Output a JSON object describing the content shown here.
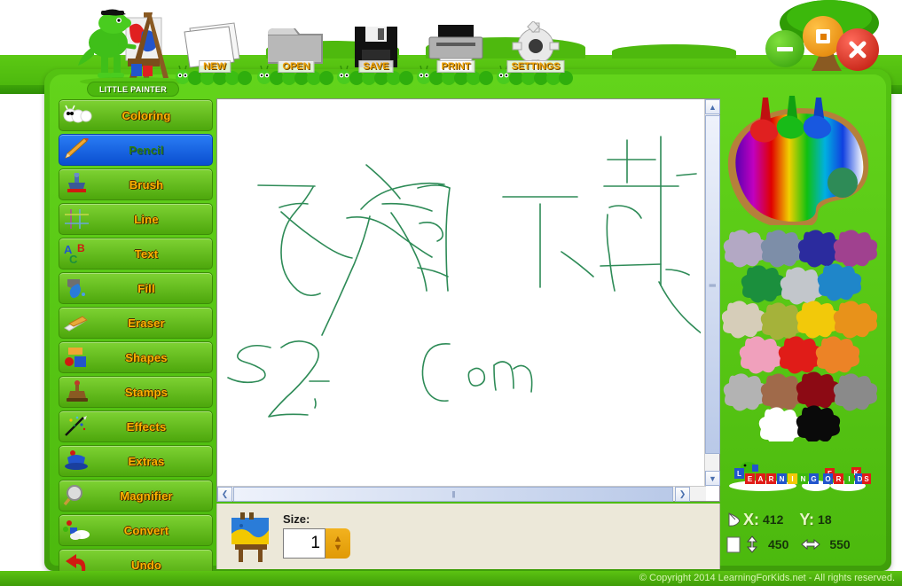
{
  "app": {
    "title": "LITTLE PAINTER",
    "footer": "© Copyright 2014 LearningForKids.net - All rights reserved."
  },
  "window_controls": [
    {
      "name": "minimize",
      "label": "–"
    },
    {
      "name": "maximize",
      "label": "□"
    },
    {
      "name": "close",
      "label": "✕"
    }
  ],
  "toolbar": {
    "items": [
      {
        "label": "NEW",
        "icon": "new-page-icon"
      },
      {
        "label": "OPEN",
        "icon": "open-folder-icon"
      },
      {
        "label": "SAVE",
        "icon": "floppy-disk-icon"
      },
      {
        "label": "PRINT",
        "icon": "printer-icon"
      },
      {
        "label": "SETTINGS",
        "icon": "gear-icon"
      }
    ]
  },
  "sidebar": {
    "items": [
      {
        "label": "Coloring",
        "icon": "caterpillar-icon",
        "active": false
      },
      {
        "label": "Pencil",
        "icon": "pencil-icon",
        "active": true
      },
      {
        "label": "Brush",
        "icon": "brush-icon",
        "active": false
      },
      {
        "label": "Line",
        "icon": "grid-lines-icon",
        "active": false
      },
      {
        "label": "Text",
        "icon": "abc-letters-icon",
        "active": false
      },
      {
        "label": "Fill",
        "icon": "paint-bucket-icon",
        "active": false
      },
      {
        "label": "Eraser",
        "icon": "eraser-icon",
        "active": false
      },
      {
        "label": "Shapes",
        "icon": "shapes-icon",
        "active": false
      },
      {
        "label": "Stamps",
        "icon": "stamp-icon",
        "active": false
      },
      {
        "label": "Effects",
        "icon": "magic-wand-icon",
        "active": false
      },
      {
        "label": "Extras",
        "icon": "hat-icon",
        "active": false
      },
      {
        "label": "Magnifier",
        "icon": "magnifier-icon",
        "active": false
      },
      {
        "label": "Convert",
        "icon": "convert-icon",
        "active": false
      },
      {
        "label": "Undo",
        "icon": "undo-arrow-icon",
        "active": false
      }
    ]
  },
  "options": {
    "easel_icon": "easel-icon",
    "size_label": "Size:",
    "size_value": "1",
    "spinner_up": "▲",
    "spinner_down": "▼"
  },
  "canvas": {
    "drawing_color": "#2e8b57",
    "strokes_description": "hand-drawn green text",
    "line1": "飞翔下载",
    "line2": "52Z.com"
  },
  "scrollbars": {
    "v_up": "▲",
    "v_down": "▼",
    "h_left": "❮",
    "h_right": "❯",
    "grip": "|||"
  },
  "palette": {
    "selected_color": "#2e8b57",
    "swatches": [
      [
        "#b3a8c4",
        "#7d8ea8",
        "#2b2b9e",
        "#a0418f"
      ],
      [
        "#1b8f3d",
        "#c2c6cb",
        "#1f86c9"
      ],
      [
        "#d6cdb9",
        "#a5b23a",
        "#f2c90a",
        "#e8921a"
      ],
      [
        "#f0a0bc",
        "#e01c18",
        "#ec8326"
      ],
      [
        "#b3b3b3",
        "#a06a4a",
        "#8c0a14",
        "#8a8a8a"
      ],
      [
        "#ffffff",
        "#0a0a0a"
      ]
    ]
  },
  "branding": {
    "learning_for_kids": "LEARNINGFORKIDS",
    "words": [
      "LEARNING",
      "FOR",
      "KIDS"
    ]
  },
  "status": {
    "mouse_icon": "mouse-icon",
    "x_key": "X:",
    "x_value": "412",
    "y_key": "Y:",
    "y_value": "18",
    "page_icon": "page-icon",
    "height_icon": "height-arrow-icon",
    "height_value": "450",
    "width_icon": "width-arrow-icon",
    "width_value": "550"
  }
}
